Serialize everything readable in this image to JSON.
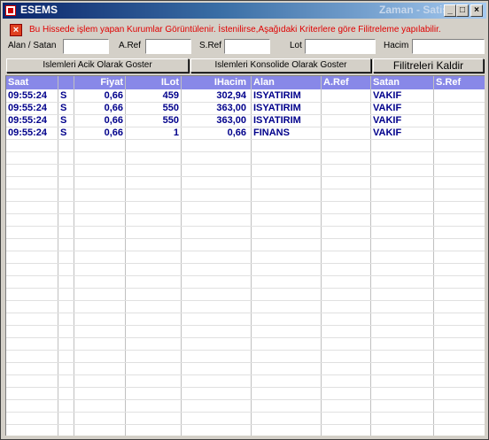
{
  "window": {
    "title": "ESEMS",
    "title_right": "Zaman - Satis",
    "minimize": "_",
    "maximize": "□",
    "close": "×"
  },
  "info": {
    "icon": "×",
    "text": "Bu Hissede işlem yapan Kurumlar Görüntülenir. İstenilirse,Aşağıdaki Kriterlere göre Filitreleme yapılabilir."
  },
  "filters": {
    "alan_satan_label": "Alan / Satan",
    "aref_label": "A.Ref",
    "sref_label": "S.Ref",
    "lot_label": "Lot",
    "hacim_label": "Hacim",
    "alan_satan_value": "",
    "aref_value": "",
    "sref_value": "",
    "lot_value": "",
    "hacim_value": ""
  },
  "buttons": {
    "acik": "Islemleri Acik Olarak Goster",
    "konsolide": "Islemleri Konsolide Olarak Goster",
    "filtre": "Filitreleri Kaldir"
  },
  "table": {
    "headers": [
      "Saat",
      "",
      "Fiyat",
      "ILot",
      "IHacim",
      "Alan",
      "A.Ref",
      "Satan",
      "S.Ref"
    ],
    "rows": [
      [
        "09:55:24",
        "S",
        "0,66",
        "459",
        "302,94",
        "ISYATIRIM",
        "",
        "VAKIF",
        ""
      ],
      [
        "09:55:24",
        "S",
        "0,66",
        "550",
        "363,00",
        "ISYATIRIM",
        "",
        "VAKIF",
        ""
      ],
      [
        "09:55:24",
        "S",
        "0,66",
        "550",
        "363,00",
        "ISYATIRIM",
        "",
        "VAKIF",
        ""
      ],
      [
        "09:55:24",
        "S",
        "0,66",
        "1",
        "0,66",
        "FINANS",
        "",
        "VAKIF",
        ""
      ]
    ]
  },
  "colors": {
    "header_bg": "#8888e8",
    "row_text": "#00008b",
    "info_text": "#e00000"
  }
}
